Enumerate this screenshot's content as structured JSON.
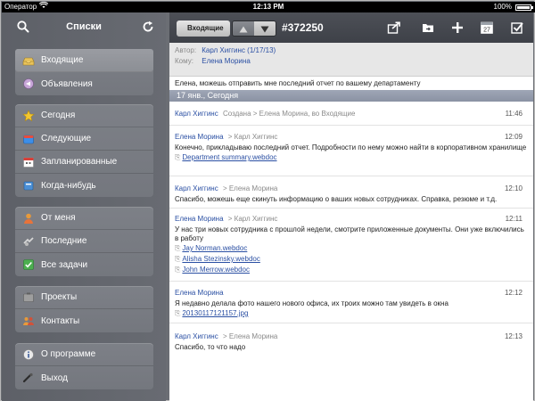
{
  "statusbar": {
    "carrier": "Оператор",
    "time": "12:13 PM",
    "battery": "100%"
  },
  "sidebar": {
    "title": "Списки",
    "groups": [
      {
        "items": [
          {
            "label": "Входящие",
            "icon": "inbox-tray-icon",
            "active": true
          },
          {
            "label": "Объявления",
            "icon": "announcements-icon"
          }
        ]
      },
      {
        "items": [
          {
            "label": "Сегодня",
            "icon": "star-icon"
          },
          {
            "label": "Следующие",
            "icon": "next-folder-icon"
          },
          {
            "label": "Запланированные",
            "icon": "calendar-icon"
          },
          {
            "label": "Когда-нибудь",
            "icon": "someday-box-icon"
          }
        ]
      },
      {
        "items": [
          {
            "label": "От меня",
            "icon": "person-icon"
          },
          {
            "label": "Последние",
            "icon": "recent-icon"
          },
          {
            "label": "Все задачи",
            "icon": "all-tasks-icon"
          }
        ]
      },
      {
        "items": [
          {
            "label": "Проекты",
            "icon": "projects-icon"
          },
          {
            "label": "Контакты",
            "icon": "contacts-icon"
          }
        ]
      },
      {
        "items": [
          {
            "label": "О программе",
            "icon": "info-icon"
          },
          {
            "label": "Выход",
            "icon": "logout-icon"
          }
        ]
      }
    ]
  },
  "toolbar": {
    "back_label": "Входящие",
    "ticket_number": "#372250",
    "calendar_day": "27"
  },
  "header": {
    "author_label": "Автор:",
    "author_value": "Карл Хиггинс (1/17/13)",
    "to_label": "Кому:",
    "to_value": "Елена Морина",
    "subject": "Елена, можешь отправить мне последний отчет по вашему департаменту",
    "date": "17 янв., Сегодня"
  },
  "messages": [
    {
      "from": "Карл Хиггинс",
      "to": "Создана > Елена Морина, во Входящие",
      "time": "11:46",
      "body": "",
      "attachments": []
    },
    {
      "from": "Елена Морина",
      "to": "> Карл Хиггинс",
      "time": "12:09",
      "body": "Конечно, прикладываю последний отчет. Подробности по нему можно найти в корпоративном хранилище",
      "attachments": [
        "Department summary.webdoc"
      ]
    },
    {
      "from": "Карл Хиггинс",
      "to": "> Елена Морина",
      "time": "12:10",
      "body": "Спасибо, можешь еще скинуть информацию о ваших новых сотрудниках. Справка, резюме и т.д.",
      "attachments": []
    },
    {
      "from": "Елена Морина",
      "to": "> Карл Хиггинс",
      "time": "12:11",
      "body": "У нас три новых сотрудника с прошлой недели, смотрите приложенные документы. Они уже включились в работу",
      "attachments": [
        "Jay Norman.webdoc",
        "Alisha Stezinsky.webdoc",
        "John Merrow.webdoc"
      ]
    },
    {
      "from": "Елена Морина",
      "to": "",
      "time": "12:12",
      "body": "Я недавно делала фото нашего нового офиса, их троих можно там увидеть в окна",
      "attachments": [
        "20130117121157.jpg"
      ]
    },
    {
      "from": "Карл Хиггинс",
      "to": "> Елена Морина",
      "time": "12:13",
      "body": "Спасибо, то что надо",
      "attachments": []
    }
  ]
}
